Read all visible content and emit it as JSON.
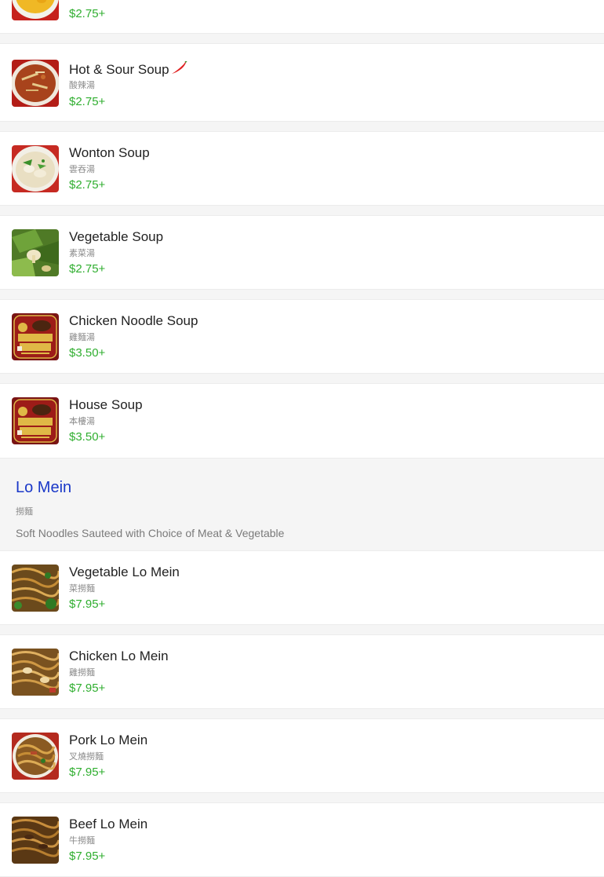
{
  "section_soup": {
    "items": [
      {
        "name": "",
        "cn": "",
        "price": "$2.75+"
      },
      {
        "name": "Hot & Sour Soup",
        "cn": "酸辣湯",
        "price": "$2.75+",
        "icon": "chili-pepper-icon"
      },
      {
        "name": "Wonton Soup",
        "cn": "雲吞湯",
        "price": "$2.75+"
      },
      {
        "name": "Vegetable Soup",
        "cn": "素菜湯",
        "price": "$2.75+"
      },
      {
        "name": "Chicken Noodle Soup",
        "cn": "雞麵湯",
        "price": "$3.50+"
      },
      {
        "name": "House Soup",
        "cn": "本樓湯",
        "price": "$3.50+"
      }
    ]
  },
  "section_lo_mein": {
    "title": "Lo Mein",
    "cn": "撈麵",
    "description": "Soft Noodles Sauteed with Choice of Meat & Vegetable",
    "items": [
      {
        "name": "Vegetable Lo Mein",
        "cn": "菜撈麵",
        "price": "$7.95+"
      },
      {
        "name": "Chicken Lo Mein",
        "cn": "雞撈麵",
        "price": "$7.95+"
      },
      {
        "name": "Pork Lo Mein",
        "cn": "叉燒撈麵",
        "price": "$7.95+"
      },
      {
        "name": "Beef Lo Mein",
        "cn": "牛撈麵",
        "price": "$7.95+"
      }
    ]
  },
  "colors": {
    "price": "#2fae2f",
    "section_title": "#1a38c8",
    "chili": "#e02020"
  }
}
